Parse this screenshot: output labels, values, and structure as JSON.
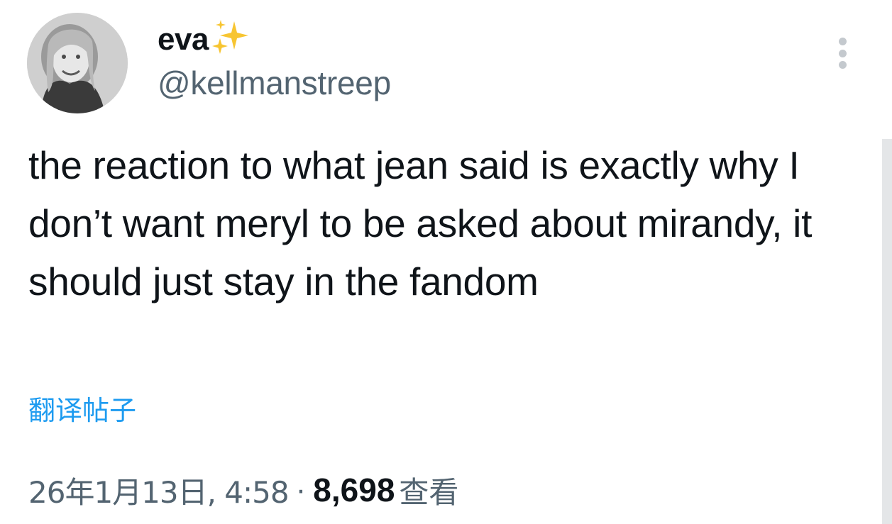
{
  "author": {
    "display_name": "eva",
    "display_name_emoji": "sparkles-icon",
    "handle": "@kellmanstreep",
    "avatar": "avatar-photo"
  },
  "post": {
    "text": "the reaction to what jean said is exactly why I don’t want meryl to be asked about mirandy, it should just stay in the fandom",
    "translate_label": "翻译帖子"
  },
  "meta": {
    "timestamp": "26年1月13日, 4:58",
    "separator": "·",
    "view_count": "8,698",
    "view_label": "查看"
  },
  "icons": {
    "more": "more-vertical-icon"
  },
  "colors": {
    "text_primary": "#0f1419",
    "text_secondary": "#536471",
    "link": "#1d9bf0",
    "sparkle": "#f7c531"
  }
}
